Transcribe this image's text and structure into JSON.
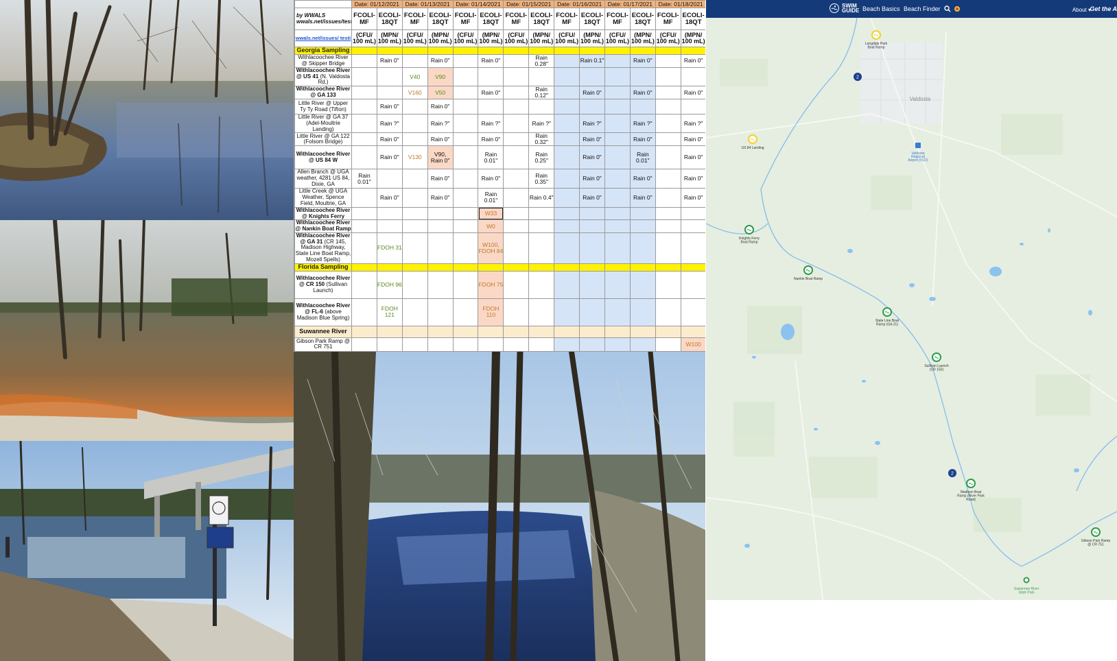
{
  "table": {
    "by_label": "by WWALS",
    "by_link": "wwals.net/issues/testing/",
    "link_row": "wwals.net/issues/ testi",
    "dates": [
      "Date: 01/12/2021",
      "Date: 01/13/2021",
      "Date: 01/14/2021",
      "Date: 01/15/2021",
      "Date: 01/16/2021",
      "Date: 01/17/2021",
      "Date: 01/18/2021"
    ],
    "headers": [
      "FCOLI-MF",
      "ECOLI-18QT",
      "FCOLI-MF",
      "ECOLI-18QT",
      "FCOLI-MF",
      "ECOLI-18QT",
      "FCOLI-MF",
      "ECOLI-18QT",
      "FCOLI-MF",
      "ECOLI-18QT",
      "FCOLI-MF",
      "ECOLI-18QT",
      "FCOLI-MF",
      "ECOLI-18QT"
    ],
    "units": [
      "(CFU/ 100 mL)",
      "(MPN/ 100 mL)",
      "(CFU/ 100 mL)",
      "(MPN/ 100 mL)",
      "(CFU/ 100 mL)",
      "(MPN/ 100 mL)",
      "(CFU/ 100 mL)",
      "(MPN/ 100 mL)",
      "(CFU/ 100 mL)",
      "(MPN/ 100 mL)",
      "(CFU/ 100 mL)",
      "(MPN/ 100 mL)",
      "(CFU/ 100 mL)",
      "(MPN/ 100 mL)"
    ],
    "georgia_section": "Georgia Sampling",
    "florida_section": "Florida Sampling",
    "suwannee_section": "Suwannee River",
    "georgia_rows": [
      {
        "site_bold": "",
        "site": "Withlacoochee River @ Skipper Bridge",
        "cells": [
          "",
          "Rain 0\"",
          "",
          "Rain 0\"",
          "",
          "Rain 0\"",
          "",
          "Rain 0.28\"",
          "",
          "Rain 0.1\"",
          "",
          "Rain 0\"",
          "",
          "Rain 0\""
        ]
      },
      {
        "site_bold": "Withlacoochee River @ US 41",
        "site": "(N. Valdosta Rd.)",
        "cells": [
          "",
          "",
          "V40",
          "V90",
          "",
          "",
          "",
          "",
          "",
          "",
          "",
          "",
          "",
          ""
        ]
      },
      {
        "site_bold": "Withlacoochee River @ GA 133",
        "site": "",
        "cells": [
          "",
          "",
          "V160",
          "V50",
          "",
          "Rain 0\"",
          "",
          "Rain 0.12\"",
          "",
          "Rain 0\"",
          "",
          "Rain 0\"",
          "",
          "Rain 0\""
        ]
      },
      {
        "site_bold": "",
        "site": "Little River @ Upper Ty Ty Road (Tifton)",
        "cells": [
          "",
          "Rain 0\"",
          "",
          "Rain 0\"",
          "",
          "",
          "",
          "",
          "",
          "",
          "",
          "",
          "",
          ""
        ]
      },
      {
        "site_bold": "",
        "site": "Little River @ GA 37 (Adel-Moultrie Landing)",
        "cells": [
          "",
          "Rain ?\"",
          "",
          "Rain ?\"",
          "",
          "Rain ?\"",
          "",
          "Rain ?\"",
          "",
          "Rain ?\"",
          "",
          "Rain ?\"",
          "",
          "Rain ?\""
        ]
      },
      {
        "site_bold": "",
        "site": "Little River @ GA 122 (Folsom Bridge)",
        "cells": [
          "",
          "Rain 0\"",
          "",
          "Rain 0\"",
          "",
          "Rain 0\"",
          "",
          "Rain 0.32\"",
          "",
          "Rain 0\"",
          "",
          "Rain 0\"",
          "",
          "Rain 0\""
        ]
      },
      {
        "site_bold": "Withlacoochee River @ US 84 W",
        "site": "",
        "cells": [
          "",
          "Rain 0\"",
          "V130",
          "V90, Rain 0\"",
          "",
          "Rain 0.01\"",
          "",
          "Rain 0.25\"",
          "",
          "Rain 0\"",
          "",
          "Rain 0.01\"",
          "",
          "Rain 0\""
        ]
      },
      {
        "site_bold": "",
        "site": "Allen Branch @ UGA weather, 4281 US 84, Dixie, GA",
        "cells": [
          "Rain 0.01\"",
          "",
          "",
          "Rain 0\"",
          "",
          "Rain 0\"",
          "",
          "Rain 0.35\"",
          "",
          "Rain 0\"",
          "",
          "Rain 0\"",
          "",
          "Rain 0\""
        ]
      },
      {
        "site_bold": "",
        "site": "Little Creek @ UGA Weather, Spence Field, Moultrie, GA",
        "cells": [
          "",
          "Rain 0\"",
          "",
          "Rain 0\"",
          "",
          "Rain 0.01\"",
          "",
          "Rain 0.4\"",
          "",
          "Rain 0\"",
          "",
          "Rain 0\"",
          "",
          "Rain 0\""
        ]
      },
      {
        "site_bold": "Withlacoochee River @ Knights Ferry",
        "site": "",
        "cells": [
          "",
          "",
          "",
          "",
          "",
          "W33",
          "",
          "",
          "",
          "",
          "",
          "",
          "",
          ""
        ]
      },
      {
        "site_bold": "Withlacoochee River @ Nankin Boat Ramp",
        "site": "",
        "cells": [
          "",
          "",
          "",
          "",
          "",
          "W0",
          "",
          "",
          "",
          "",
          "",
          "",
          "",
          ""
        ]
      },
      {
        "site_bold": "Withlacoochee River @ GA 31",
        "site": "(CR 145, Madison Highway, State Line Boat Ramp, Mozell Spells)",
        "cells": [
          "",
          "FDOH 31",
          "",
          "",
          "",
          "W100, FDOH 84",
          "",
          "",
          "",
          "",
          "",
          "",
          "",
          ""
        ]
      }
    ],
    "florida_rows": [
      {
        "site_bold": "Withlacoochee River @ CR 150",
        "site": "(Sullivan Launch)",
        "cells": [
          "",
          "FDOH 96",
          "",
          "",
          "",
          "FDOH 75",
          "",
          "",
          "",
          "",
          "",
          "",
          "",
          ""
        ]
      },
      {
        "site_bold": "Withlacoochee River @ FL-6",
        "site": "(above Madison Blue Spring)",
        "cells": [
          "",
          "FDOH 121",
          "",
          "",
          "",
          "FDOH 110",
          "",
          "",
          "",
          "",
          "",
          "",
          "",
          ""
        ]
      }
    ],
    "suwannee_rows": [
      {
        "site_bold": "",
        "site": "Gibson Park Ramp @ CR 751",
        "cells": [
          "",
          "",
          "",
          "",
          "",
          "",
          "",
          "",
          "",
          "",
          "",
          "",
          "",
          "W100"
        ]
      }
    ]
  },
  "map": {
    "logo_line1": "SWIM",
    "logo_line2": "GUIDE",
    "nav_beach_basics": "Beach Basics",
    "nav_beach_finder": "Beach Finder",
    "nav_about": "About",
    "nav_get_app": "Get the A",
    "town_valdosta": "Valdosta",
    "airport_label": "Valdosta Regional Airport (VLD)",
    "markers": [
      {
        "label": "Langdale Park Boat Ramp",
        "color": "yellow"
      },
      {
        "label": "US 84 Landing",
        "color": "yellow"
      },
      {
        "label": "Knights Ferry Boat Ramp",
        "color": "green"
      },
      {
        "label": "Nankin Boat Ramp",
        "color": "green"
      },
      {
        "label": "State Line Boat Ramp (GA 31)",
        "color": "green"
      },
      {
        "label": "Sullivan Launch (CR 150)",
        "color": "green"
      },
      {
        "label": "Madison Boat Ramp (River Park Road)",
        "color": "green"
      },
      {
        "label": "Gibson Park Ramp @ CR 751",
        "color": "green"
      },
      {
        "label": "Suwannee River State Park",
        "color": "green"
      }
    ],
    "clusters": [
      "2",
      "2"
    ],
    "colors": {
      "bar": "#153a7a",
      "green": "#2f9a4a",
      "yellow": "#f2d12b",
      "cluster": "#1c3f8e",
      "land": "#e5eee0",
      "water": "#7fb8ee"
    }
  }
}
